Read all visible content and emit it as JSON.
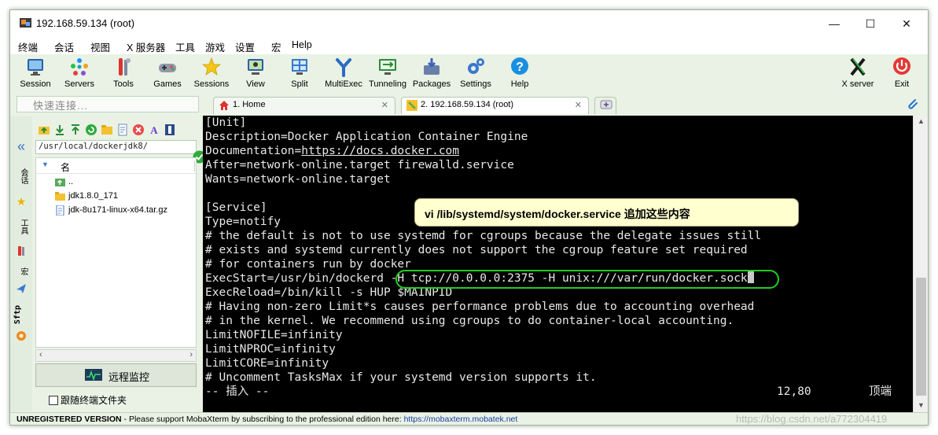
{
  "window": {
    "title": "192.168.59.134 (root)",
    "controls": {
      "minimize": "—",
      "maximize": "☐",
      "close": "✕"
    }
  },
  "menu": [
    "终端",
    "会话",
    "视图",
    "X 服务器",
    "工具",
    "游戏",
    "设置",
    "宏",
    "Help"
  ],
  "toolbar": {
    "session": "Session",
    "servers": "Servers",
    "tools": "Tools",
    "games": "Games",
    "sessions": "Sessions",
    "view": "View",
    "split": "Split",
    "multiexec": "MultiExec",
    "tunneling": "Tunneling",
    "packages": "Packages",
    "settings": "Settings",
    "help": "Help",
    "xserver": "X server",
    "exit": "Exit"
  },
  "quick_connect": {
    "placeholder": "快速连接..."
  },
  "tabs": [
    {
      "label": "1. Home"
    },
    {
      "label": "2. 192.168.59.134 (root)"
    }
  ],
  "left_strip": {
    "sessions": "会话",
    "tools": "工具",
    "macros": "宏",
    "sftp": "Sftp"
  },
  "sidebar": {
    "path": "/usr/local/dockerjdk8/",
    "column_name": "名",
    "files": [
      {
        "name": "..",
        "type": "parent"
      },
      {
        "name": "jdk1.8.0_171",
        "type": "folder"
      },
      {
        "name": "jdk-8u171-linux-x64.tar.gz",
        "type": "file"
      }
    ],
    "monitor_button": "远程监控",
    "follow_label": "跟随终端文件夹"
  },
  "terminal": {
    "lines": [
      "[Unit]",
      "Description=Docker Application Container Engine",
      "Documentation=",
      "After=network-online.target firewalld.service",
      "Wants=network-online.target",
      "",
      "[Service]",
      "Type=notify",
      "# the default is not to use systemd for cgroups because the delegate issues still",
      "# exists and systemd currently does not support the cgroup feature set required",
      "# for containers run by docker",
      "ExecStart=/usr/bin/dockerd -H tcp://0.0.0.0:2375 -H unix:///var/run/docker.sock",
      "ExecReload=/bin/kill -s HUP $MAINPID",
      "# Having non-zero Limit*s causes performance problems due to accounting overhead",
      "# in the kernel. We recommend using cgroups to do container-local accounting.",
      "LimitNOFILE=infinity",
      "LimitNPROC=infinity",
      "LimitCORE=infinity",
      "# Uncomment TasksMax if your systemd version supports it.",
      "-- 插入 --"
    ],
    "doc_link": "https://docs.docker.com",
    "cursor_pos": "12,80",
    "scroll_pos": "顶端"
  },
  "callout": "vi /lib/systemd/system/docker.service 追加这些内容",
  "status": {
    "unregistered": "UNREGISTERED VERSION",
    "message": "  -  Please support MobaXterm by subscribing to the professional edition here:  ",
    "url": "https://mobaxterm.mobatek.net"
  },
  "watermark": "https://blog.csdn.net/a772304419",
  "colors": {
    "terminal_bg": "#000000",
    "highlight": "#22cc22",
    "callout_bg": "#ffffd0",
    "chrome_bg": "#e9f2e4"
  }
}
